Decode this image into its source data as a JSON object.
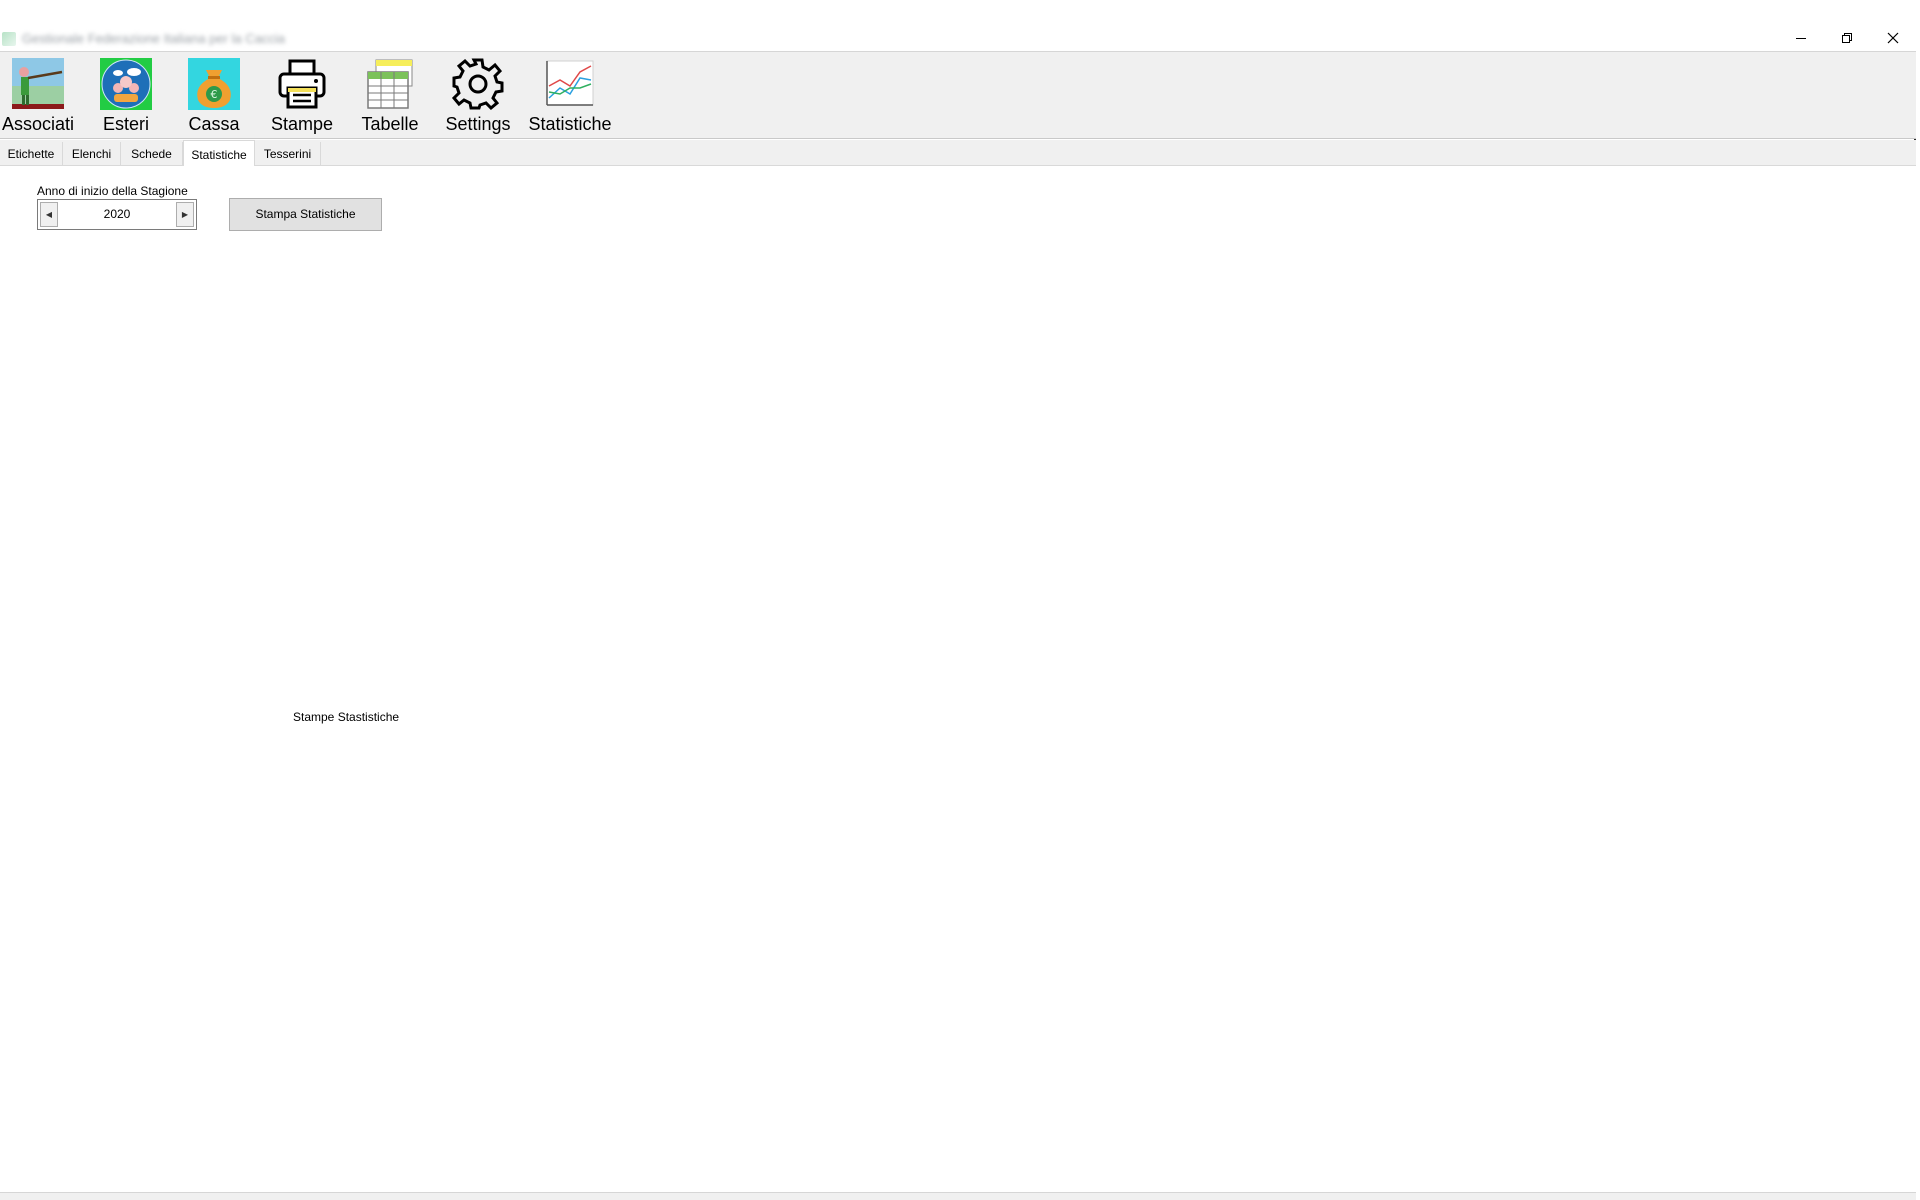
{
  "window": {
    "title": "Gestionale Federazione Italiana per la Caccia"
  },
  "ribbon": {
    "items": [
      {
        "label": "Associati",
        "icon": "hunter-icon"
      },
      {
        "label": "Esteri",
        "icon": "globe-people-icon"
      },
      {
        "label": "Cassa",
        "icon": "money-bag-icon"
      },
      {
        "label": "Stampe",
        "icon": "printer-icon"
      },
      {
        "label": "Tabelle",
        "icon": "table-icon"
      },
      {
        "label": "Settings",
        "icon": "gear-icon"
      },
      {
        "label": "Statistiche",
        "icon": "line-chart-icon"
      }
    ]
  },
  "tabs": [
    {
      "label": "Etichette",
      "active": false
    },
    {
      "label": "Elenchi",
      "active": false
    },
    {
      "label": "Schede",
      "active": false
    },
    {
      "label": "Statistiche",
      "active": true
    },
    {
      "label": "Tesserini",
      "active": false
    }
  ],
  "form": {
    "season_label": "Anno di inizio della Stagione",
    "season_value": "2020",
    "print_button": "Stampa Statistiche",
    "caption": "Stampe Stastistiche"
  },
  "colors": {
    "ribbon_bg": "#f0f0f0",
    "button_bg": "#e1e1e1",
    "content_bg": "#ffffff"
  }
}
